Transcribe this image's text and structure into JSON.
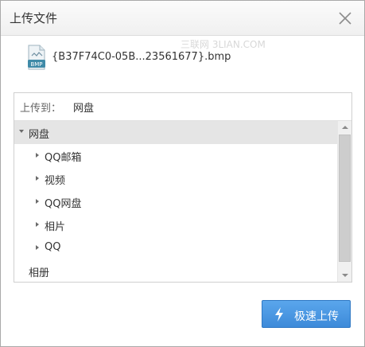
{
  "dialog": {
    "title": "上传文件",
    "watermark": "三联网 3LIAN.COM"
  },
  "file": {
    "icon_text": "BMP",
    "name": "{B37F74C0-05B...23561677}.bmp"
  },
  "upload_to": {
    "label": "上传到：",
    "value": "网盘"
  },
  "tree": {
    "root": "网盘",
    "children": [
      "QQ邮箱",
      "视频",
      "QQ网盘",
      "相片",
      "QQ"
    ],
    "next_root": "相册"
  },
  "upload_button": {
    "label": "极速上传"
  },
  "colors": {
    "accent": "#3d8ad9",
    "selected_row": "#e5e5e5"
  },
  "icons": [
    "close-icon",
    "bmp-file-icon",
    "lightning-icon"
  ]
}
